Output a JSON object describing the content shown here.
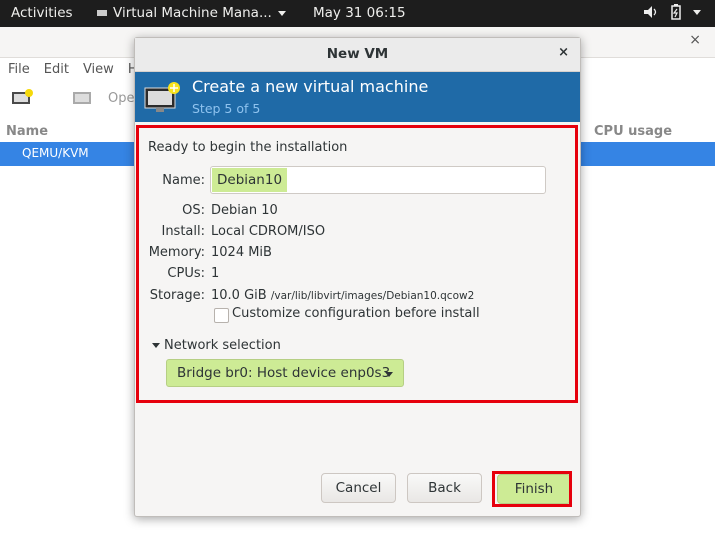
{
  "topbar": {
    "activities": "Activities",
    "app_menu": "Virtual Machine Mana...",
    "clock": "May 31  06:15"
  },
  "main_window": {
    "menu": [
      "File",
      "Edit",
      "View",
      "H"
    ],
    "toolbar_open": "Open",
    "columns": {
      "name": "Name",
      "cpu": "CPU usage"
    },
    "connection": "QEMU/KVM"
  },
  "dialog": {
    "title": "New VM",
    "close": "×",
    "banner_title": "Create a new virtual machine",
    "banner_step": "Step 5 of 5",
    "ready_text": "Ready to begin the installation",
    "fields": {
      "name_label": "Name:",
      "name_value": "Debian10",
      "os_label": "OS:",
      "os_value": "Debian 10",
      "install_label": "Install:",
      "install_value": "Local CDROM/ISO",
      "memory_label": "Memory:",
      "memory_value": "1024 MiB",
      "cpus_label": "CPUs:",
      "cpus_value": "1",
      "storage_label": "Storage:",
      "storage_size": "10.0 GiB",
      "storage_path": "/var/lib/libvirt/images/Debian10.qcow2"
    },
    "customize_label": "Customize configuration before install",
    "customize_checked": false,
    "network_label": "Network selection",
    "network_value": "Bridge br0: Host device enp0s3",
    "buttons": {
      "cancel": "Cancel",
      "back": "Back",
      "finish": "Finish"
    }
  },
  "colors": {
    "banner": "#1f6aa7",
    "selection": "#cdeb95",
    "highlight": "#e6000c",
    "row_selected": "#3584e4"
  }
}
